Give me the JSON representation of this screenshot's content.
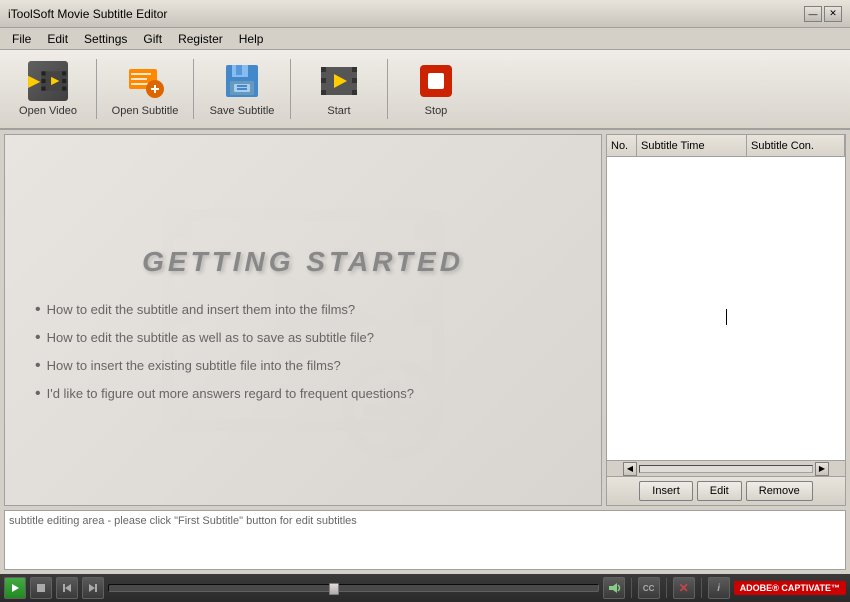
{
  "app": {
    "title": "iToolSoft Movie Subtitle Editor",
    "divider": "|"
  },
  "title_controls": {
    "minimize": "—",
    "close": "✕"
  },
  "menu": {
    "items": [
      "File",
      "Edit",
      "Settings",
      "Gift",
      "Register",
      "Help"
    ]
  },
  "toolbar": {
    "buttons": [
      {
        "id": "open-video",
        "label": "Open Video",
        "icon": "film-icon"
      },
      {
        "id": "open-subtitle",
        "label": "Open Subtitle",
        "icon": "subtitle-add-icon"
      },
      {
        "id": "save-subtitle",
        "label": "Save Subtitle",
        "icon": "save-icon"
      },
      {
        "id": "start",
        "label": "Start",
        "icon": "start-icon"
      },
      {
        "id": "stop",
        "label": "Stop",
        "icon": "stop-icon"
      }
    ]
  },
  "preview": {
    "title": "GETTING  STARTED",
    "bullets": [
      "How to edit the subtitle and insert them into the films?",
      "How to edit the subtitle as well as to save as subtitle file?",
      "How to insert the existing subtitle file into the films?",
      "I'd like to figure out more answers regard to frequent questions?"
    ]
  },
  "subtitle_table": {
    "columns": [
      "No.",
      "Subtitle Time",
      "Subtitle Con."
    ],
    "rows": []
  },
  "subtitle_buttons": {
    "insert": "Insert",
    "edit": "Edit",
    "remove": "Remove"
  },
  "edit_area": {
    "placeholder": "subtitle editing area - please click \"First Subtitle\" button for edit subtitles"
  },
  "player": {
    "buttons": [
      "play",
      "stop",
      "prev",
      "next"
    ],
    "adobe_label": "ADOBE® CAPTIVATE™"
  }
}
